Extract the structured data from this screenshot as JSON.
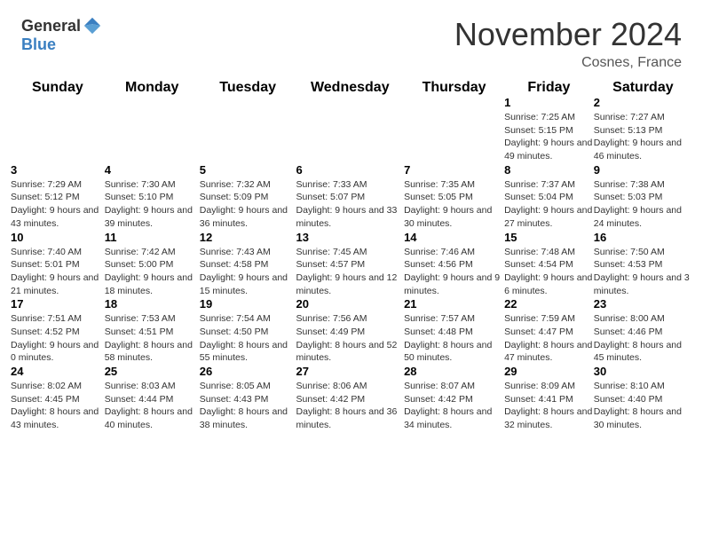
{
  "header": {
    "logo_general": "General",
    "logo_blue": "Blue",
    "month_title": "November 2024",
    "location": "Cosnes, France"
  },
  "weekdays": [
    "Sunday",
    "Monday",
    "Tuesday",
    "Wednesday",
    "Thursday",
    "Friday",
    "Saturday"
  ],
  "weeks": [
    [
      {
        "day": "",
        "info": ""
      },
      {
        "day": "",
        "info": ""
      },
      {
        "day": "",
        "info": ""
      },
      {
        "day": "",
        "info": ""
      },
      {
        "day": "",
        "info": ""
      },
      {
        "day": "1",
        "info": "Sunrise: 7:25 AM\nSunset: 5:15 PM\nDaylight: 9 hours and 49 minutes."
      },
      {
        "day": "2",
        "info": "Sunrise: 7:27 AM\nSunset: 5:13 PM\nDaylight: 9 hours and 46 minutes."
      }
    ],
    [
      {
        "day": "3",
        "info": "Sunrise: 7:29 AM\nSunset: 5:12 PM\nDaylight: 9 hours and 43 minutes."
      },
      {
        "day": "4",
        "info": "Sunrise: 7:30 AM\nSunset: 5:10 PM\nDaylight: 9 hours and 39 minutes."
      },
      {
        "day": "5",
        "info": "Sunrise: 7:32 AM\nSunset: 5:09 PM\nDaylight: 9 hours and 36 minutes."
      },
      {
        "day": "6",
        "info": "Sunrise: 7:33 AM\nSunset: 5:07 PM\nDaylight: 9 hours and 33 minutes."
      },
      {
        "day": "7",
        "info": "Sunrise: 7:35 AM\nSunset: 5:05 PM\nDaylight: 9 hours and 30 minutes."
      },
      {
        "day": "8",
        "info": "Sunrise: 7:37 AM\nSunset: 5:04 PM\nDaylight: 9 hours and 27 minutes."
      },
      {
        "day": "9",
        "info": "Sunrise: 7:38 AM\nSunset: 5:03 PM\nDaylight: 9 hours and 24 minutes."
      }
    ],
    [
      {
        "day": "10",
        "info": "Sunrise: 7:40 AM\nSunset: 5:01 PM\nDaylight: 9 hours and 21 minutes."
      },
      {
        "day": "11",
        "info": "Sunrise: 7:42 AM\nSunset: 5:00 PM\nDaylight: 9 hours and 18 minutes."
      },
      {
        "day": "12",
        "info": "Sunrise: 7:43 AM\nSunset: 4:58 PM\nDaylight: 9 hours and 15 minutes."
      },
      {
        "day": "13",
        "info": "Sunrise: 7:45 AM\nSunset: 4:57 PM\nDaylight: 9 hours and 12 minutes."
      },
      {
        "day": "14",
        "info": "Sunrise: 7:46 AM\nSunset: 4:56 PM\nDaylight: 9 hours and 9 minutes."
      },
      {
        "day": "15",
        "info": "Sunrise: 7:48 AM\nSunset: 4:54 PM\nDaylight: 9 hours and 6 minutes."
      },
      {
        "day": "16",
        "info": "Sunrise: 7:50 AM\nSunset: 4:53 PM\nDaylight: 9 hours and 3 minutes."
      }
    ],
    [
      {
        "day": "17",
        "info": "Sunrise: 7:51 AM\nSunset: 4:52 PM\nDaylight: 9 hours and 0 minutes."
      },
      {
        "day": "18",
        "info": "Sunrise: 7:53 AM\nSunset: 4:51 PM\nDaylight: 8 hours and 58 minutes."
      },
      {
        "day": "19",
        "info": "Sunrise: 7:54 AM\nSunset: 4:50 PM\nDaylight: 8 hours and 55 minutes."
      },
      {
        "day": "20",
        "info": "Sunrise: 7:56 AM\nSunset: 4:49 PM\nDaylight: 8 hours and 52 minutes."
      },
      {
        "day": "21",
        "info": "Sunrise: 7:57 AM\nSunset: 4:48 PM\nDaylight: 8 hours and 50 minutes."
      },
      {
        "day": "22",
        "info": "Sunrise: 7:59 AM\nSunset: 4:47 PM\nDaylight: 8 hours and 47 minutes."
      },
      {
        "day": "23",
        "info": "Sunrise: 8:00 AM\nSunset: 4:46 PM\nDaylight: 8 hours and 45 minutes."
      }
    ],
    [
      {
        "day": "24",
        "info": "Sunrise: 8:02 AM\nSunset: 4:45 PM\nDaylight: 8 hours and 43 minutes."
      },
      {
        "day": "25",
        "info": "Sunrise: 8:03 AM\nSunset: 4:44 PM\nDaylight: 8 hours and 40 minutes."
      },
      {
        "day": "26",
        "info": "Sunrise: 8:05 AM\nSunset: 4:43 PM\nDaylight: 8 hours and 38 minutes."
      },
      {
        "day": "27",
        "info": "Sunrise: 8:06 AM\nSunset: 4:42 PM\nDaylight: 8 hours and 36 minutes."
      },
      {
        "day": "28",
        "info": "Sunrise: 8:07 AM\nSunset: 4:42 PM\nDaylight: 8 hours and 34 minutes."
      },
      {
        "day": "29",
        "info": "Sunrise: 8:09 AM\nSunset: 4:41 PM\nDaylight: 8 hours and 32 minutes."
      },
      {
        "day": "30",
        "info": "Sunrise: 8:10 AM\nSunset: 4:40 PM\nDaylight: 8 hours and 30 minutes."
      }
    ]
  ]
}
